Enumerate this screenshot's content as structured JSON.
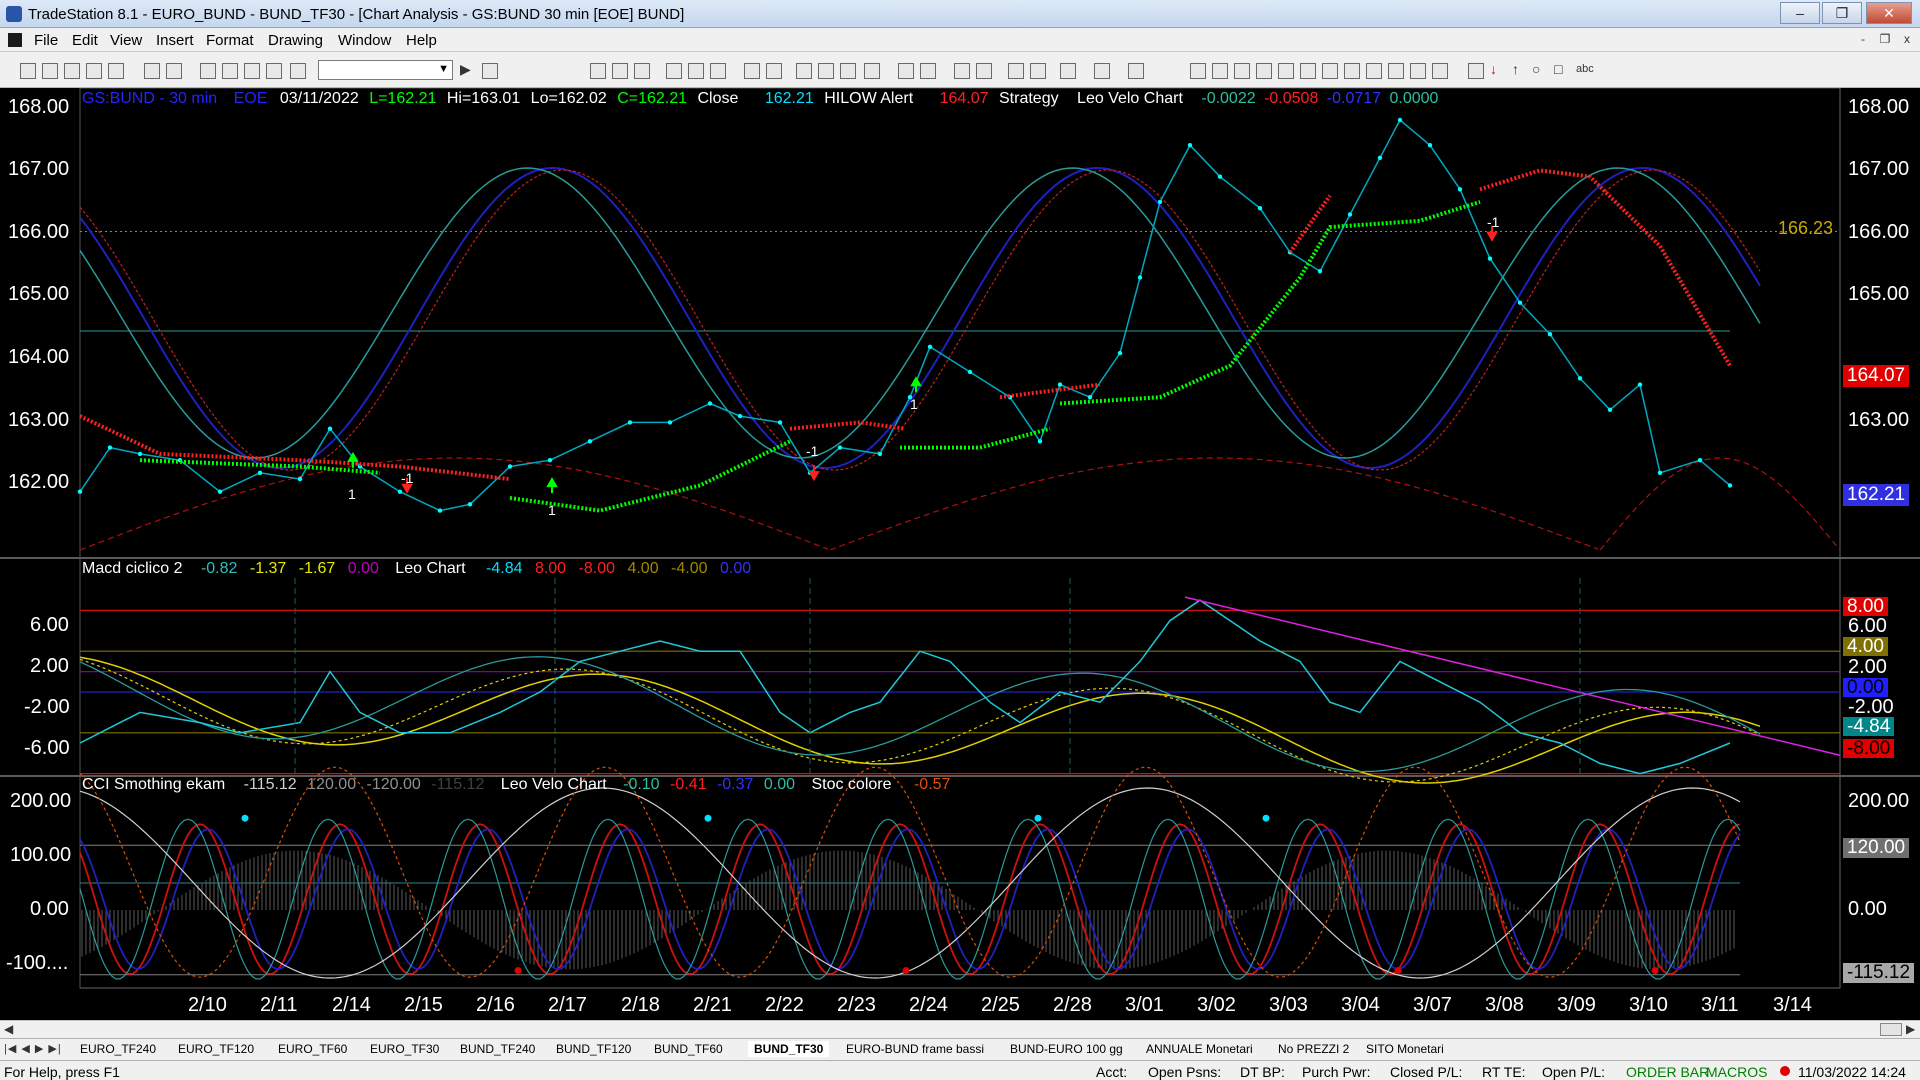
{
  "window": {
    "title": "TradeStation 8.1 - EURO_BUND - BUND_TF30 - [Chart Analysis - GS:BUND  30 min  [EOE] BUND]",
    "minimize": "–",
    "restore": "❐",
    "close": "✕"
  },
  "menu": [
    "File",
    "Edit",
    "View",
    "Insert",
    "Format",
    "Drawing",
    "Window",
    "Help"
  ],
  "mdi": {
    "minimize": "-",
    "restore": "❐",
    "close": "x"
  },
  "price_panel": {
    "symbol": "GS:BUND - 30 min",
    "exchange": "EOE",
    "date": "03/11/2022",
    "last": "L=162.21",
    "high": "Hi=163.01",
    "low": "Lo=162.02",
    "close_val": "C=162.21",
    "close_label": "Close",
    "close_price": "162.21",
    "hilow_label": "HILOW Alert",
    "hilow_val": "164.07",
    "strategy_label": "Strategy",
    "velo_label": "Leo Velo Chart",
    "velo_vals": [
      "-0.0022",
      "-0.0508",
      "-0.0717",
      "0.0000"
    ],
    "y_ticks": [
      "168.00",
      "167.00",
      "166.00",
      "165.00",
      "164.00",
      "163.00",
      "162.00"
    ],
    "level_label": "166.23",
    "box_red": "164.07",
    "box_blue": "162.21"
  },
  "macd_panel": {
    "title": "Macd ciclico 2",
    "vals": [
      "-0.82",
      "-1.37",
      "-1.67",
      "0.00"
    ],
    "leo_label": "Leo Chart",
    "leo_vals": [
      "-4.84",
      "8.00",
      "-8.00",
      "4.00",
      "-4.00",
      "0.00"
    ],
    "y_ticks": [
      "6.00",
      "2.00",
      "-2.00",
      "-6.00"
    ],
    "right_ticks": [
      "8.00",
      "6.00",
      "4.00",
      "2.00",
      "0.00",
      "-2.00",
      "-4.84",
      "-8.00"
    ]
  },
  "cci_panel": {
    "title": "CCI Smothing ekam",
    "vals": [
      "-115.12",
      "120.00",
      "-120.00",
      "-115.12"
    ],
    "velo_label": "Leo Velo Chart",
    "velo_vals": [
      "-0.10",
      "-0.41",
      "-0.37",
      "0.00"
    ],
    "stoc_label": "Stoc colore",
    "stoc_val": "-0.57",
    "y_ticks": [
      "200.00",
      "100.00",
      "0.00",
      "-100...."
    ],
    "right_ticks": [
      "200.00",
      "120.00",
      "0.00",
      "-115.12"
    ]
  },
  "x_ticks": [
    "2/10",
    "2/11",
    "2/14",
    "2/15",
    "2/16",
    "2/17",
    "2/18",
    "2/21",
    "2/22",
    "2/23",
    "2/24",
    "2/25",
    "2/28",
    "3/01",
    "3/02",
    "3/03",
    "3/04",
    "3/07",
    "3/08",
    "3/09",
    "3/10",
    "3/11",
    "3/14"
  ],
  "signals": {
    "minus_one": "-1",
    "one": "1"
  },
  "tabs": [
    "EURO_TF240",
    "EURO_TF120",
    "EURO_TF60",
    "EURO_TF30",
    "BUND_TF240",
    "BUND_TF120",
    "BUND_TF60",
    "BUND_TF30",
    "EURO-BUND frame bassi",
    "BUND-EURO 100 gg",
    "ANNUALE Monetari",
    "No PREZZI 2",
    "SITO Monetari"
  ],
  "active_tab": "BUND_TF30",
  "status": {
    "help": "For Help, press F1",
    "acct": "Acct:",
    "open_psns": "Open Psns:",
    "dt_bp": "DT BP:",
    "purch_pwr": "Purch Pwr:",
    "closed_pl": "Closed P/L:",
    "rt_te": "RT TE:",
    "open_pl": "Open P/L:",
    "order_bar": "ORDER BAR",
    "macros": "MACROS",
    "datetime": "11/03/2022 14:24"
  },
  "colors": {
    "bg": "#000000",
    "price": "#00ffff",
    "green": "#00ff00",
    "red": "#ff2020",
    "navy": "#2020c0",
    "teal": "#2a9a9a",
    "yellow": "#e8e800",
    "magenta": "#e020e0"
  }
}
